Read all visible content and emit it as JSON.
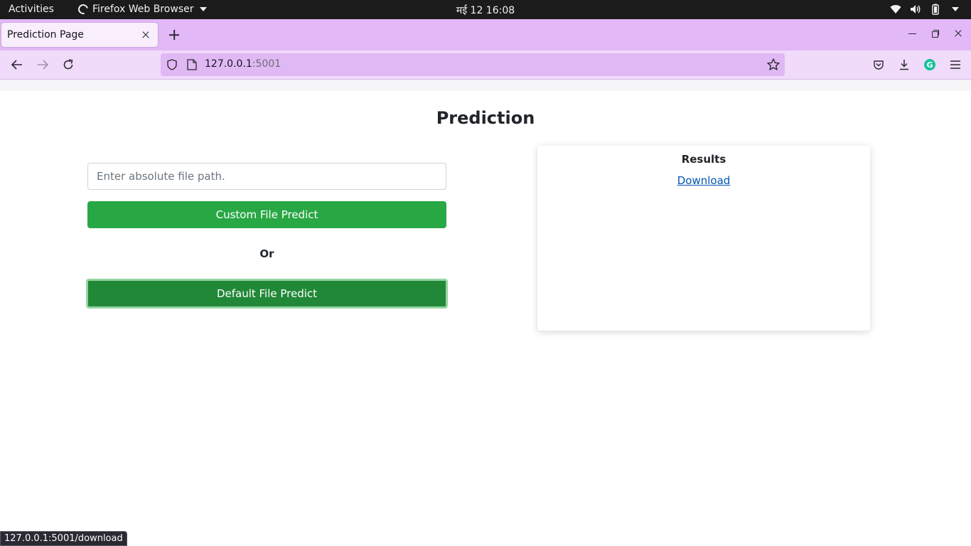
{
  "system_bar": {
    "activities": "Activities",
    "app_name": "Firefox Web Browser",
    "clock": "मई 12  16:08"
  },
  "browser": {
    "tab_title": "Prediction Page",
    "url_host": "127.0.0.1",
    "url_port": ":5001",
    "status_url": "127.0.0.1:5001/download"
  },
  "page": {
    "heading": "Prediction",
    "path_input": {
      "placeholder": "Enter absolute file path.",
      "value": ""
    },
    "custom_button": "Custom File Predict",
    "or_label": "Or",
    "default_button": "Default File Predict",
    "results": {
      "title": "Results",
      "link": "Download"
    }
  },
  "colors": {
    "success": "#28a745",
    "success_active": "#218838",
    "link": "#0056b3",
    "tabstrip": "#e3b8f6"
  }
}
